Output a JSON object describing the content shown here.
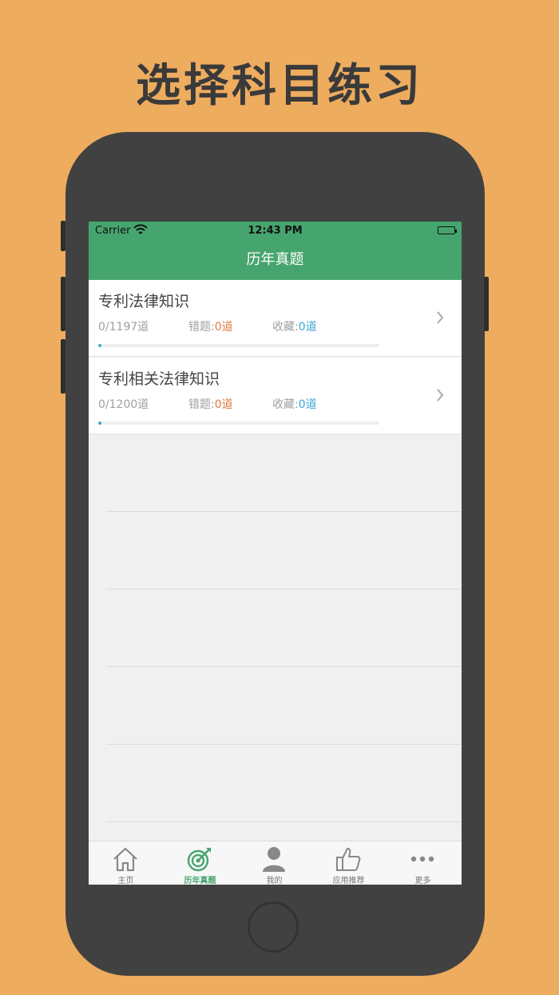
{
  "headline": "选择科目练习",
  "status_bar": {
    "carrier": "Carrier",
    "time": "12:43 PM"
  },
  "nav": {
    "title": "历年真题"
  },
  "subjects": [
    {
      "name": "专利法律知识",
      "progress_text": "0/1197道",
      "wrong_label": "错题:",
      "wrong_value": "0道",
      "fav_label": "收藏:",
      "fav_value": "0道",
      "progress_fraction": 0
    },
    {
      "name": "专利相关法律知识",
      "progress_text": "0/1200道",
      "wrong_label": "错题:",
      "wrong_value": "0道",
      "fav_label": "收藏:",
      "fav_value": "0道",
      "progress_fraction": 0
    }
  ],
  "tabs": [
    {
      "label": "主页",
      "icon": "home-icon",
      "active": false
    },
    {
      "label": "历年真题",
      "icon": "target-icon",
      "active": true
    },
    {
      "label": "我的",
      "icon": "person-icon",
      "active": false
    },
    {
      "label": "应用推荐",
      "icon": "thumbs-up-icon",
      "active": false
    },
    {
      "label": "更多",
      "icon": "more-dots-icon",
      "active": false
    }
  ],
  "colors": {
    "background": "#EEAC5F",
    "accent_green": "#46A56E",
    "wrong_orange": "#E07A3F",
    "fav_blue": "#3AA6D8"
  }
}
